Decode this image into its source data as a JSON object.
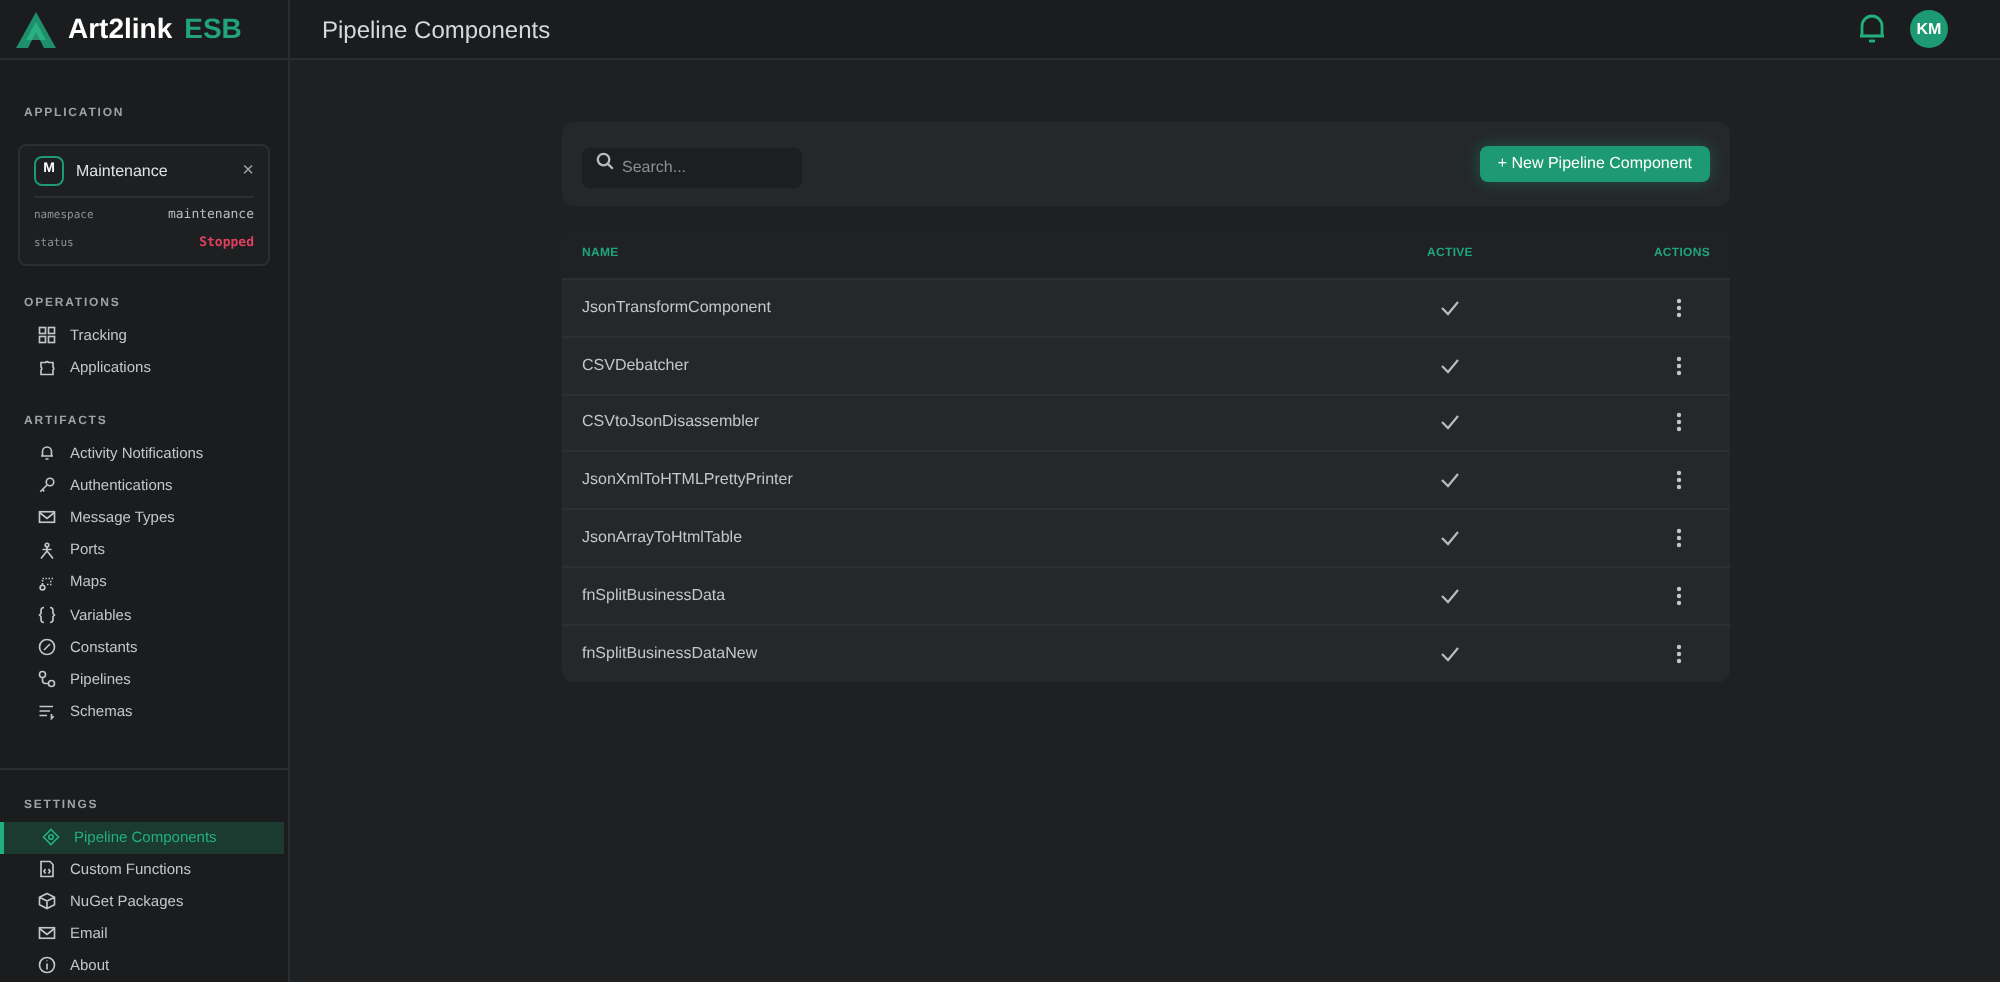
{
  "brand": {
    "name": "Art2link",
    "suffix": "ESB"
  },
  "header": {
    "title": "Pipeline Components",
    "avatar": "KM"
  },
  "application": {
    "heading": "APPLICATION",
    "initial": "M",
    "name": "Maintenance",
    "close": "×",
    "fields": [
      {
        "label": "namespace",
        "value": "maintenance",
        "kind": "plain"
      },
      {
        "label": "status",
        "value": "Stopped",
        "kind": "alert"
      }
    ]
  },
  "sections": [
    {
      "heading": "OPERATIONS",
      "items": [
        {
          "label": "Tracking",
          "selected": false
        },
        {
          "label": "Applications",
          "selected": false
        }
      ]
    },
    {
      "heading": "ARTIFACTS",
      "items": [
        {
          "label": "Activity Notifications",
          "selected": false
        },
        {
          "label": "Authentications",
          "selected": false
        },
        {
          "label": "Message Types",
          "selected": false
        },
        {
          "label": "Ports",
          "selected": false
        },
        {
          "label": "Maps",
          "selected": false
        },
        {
          "label": "Variables",
          "selected": false
        },
        {
          "label": "Constants",
          "selected": false
        },
        {
          "label": "Pipelines",
          "selected": false
        },
        {
          "label": "Schemas",
          "selected": false
        }
      ]
    },
    {
      "heading": "SETTINGS",
      "items": [
        {
          "label": "Pipeline Components",
          "selected": true
        },
        {
          "label": "Custom Functions",
          "selected": false
        },
        {
          "label": "NuGet Packages",
          "selected": false
        },
        {
          "label": "Email",
          "selected": false
        },
        {
          "label": "About",
          "selected": false
        }
      ]
    }
  ],
  "search": {
    "placeholder": "Search..."
  },
  "new_button": "+ New Pipeline Component",
  "table": {
    "columns": [
      "NAME",
      "ACTIVE",
      "ACTIONS"
    ],
    "rows": [
      {
        "name": "JsonTransformComponent",
        "active": true
      },
      {
        "name": "CSVDebatcher",
        "active": true
      },
      {
        "name": "CSVtoJsonDisassembler",
        "active": true
      },
      {
        "name": "JsonXmlToHTMLPrettyPrinter",
        "active": true
      },
      {
        "name": "JsonArrayToHtmlTable",
        "active": true
      },
      {
        "name": "fnSplitBusinessData",
        "active": true
      },
      {
        "name": "fnSplitBusinessDataNew",
        "active": true
      }
    ]
  }
}
